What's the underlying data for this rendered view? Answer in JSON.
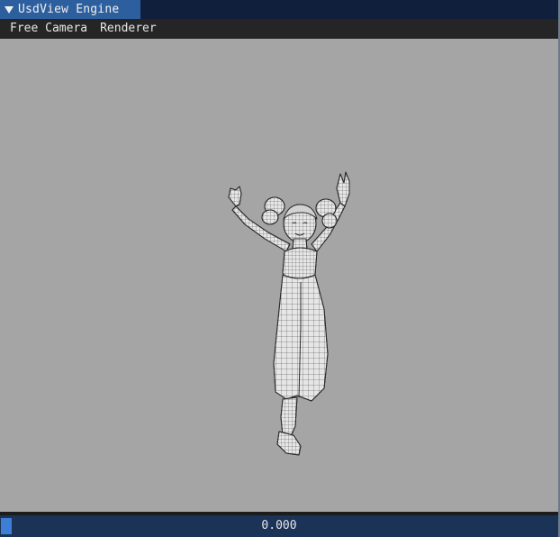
{
  "window": {
    "title": "UsdView Engine",
    "collapse_icon": "triangle-down-icon"
  },
  "menubar": {
    "items": [
      {
        "label": "Free Camera"
      },
      {
        "label": "Renderer"
      }
    ]
  },
  "viewport": {
    "background": "#a5a5a5",
    "content": "wireframe-character-model"
  },
  "timeline": {
    "value": "0.000",
    "progress": 0.02,
    "accent": "#3d7fd6"
  },
  "colors": {
    "title_active": "#2d5f9e",
    "title_bar": "#0f1f3c",
    "menubar": "#252525",
    "timeline_bg": "#1c3358"
  }
}
